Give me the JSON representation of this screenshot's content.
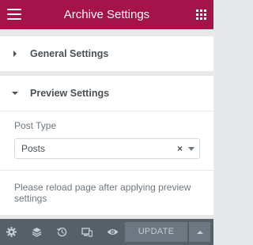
{
  "header": {
    "title": "Archive Settings",
    "menu_icon": "hamburger-icon",
    "apps_icon": "grid-icon"
  },
  "sections": {
    "general": {
      "title": "General Settings",
      "expanded": false
    },
    "preview": {
      "title": "Preview Settings",
      "expanded": true,
      "post_type_label": "Post Type",
      "post_type_value": "Posts",
      "clear_symbol": "×",
      "note": "Please reload page after applying preview settings"
    }
  },
  "footer": {
    "icons": [
      "settings-icon",
      "layers-icon",
      "history-icon",
      "responsive-icon",
      "preview-eye-icon"
    ],
    "update_label": "UPDATE"
  },
  "colors": {
    "header_bg": "#a4134a",
    "footer_bg": "#556068",
    "update_bg": "#6d7882"
  }
}
